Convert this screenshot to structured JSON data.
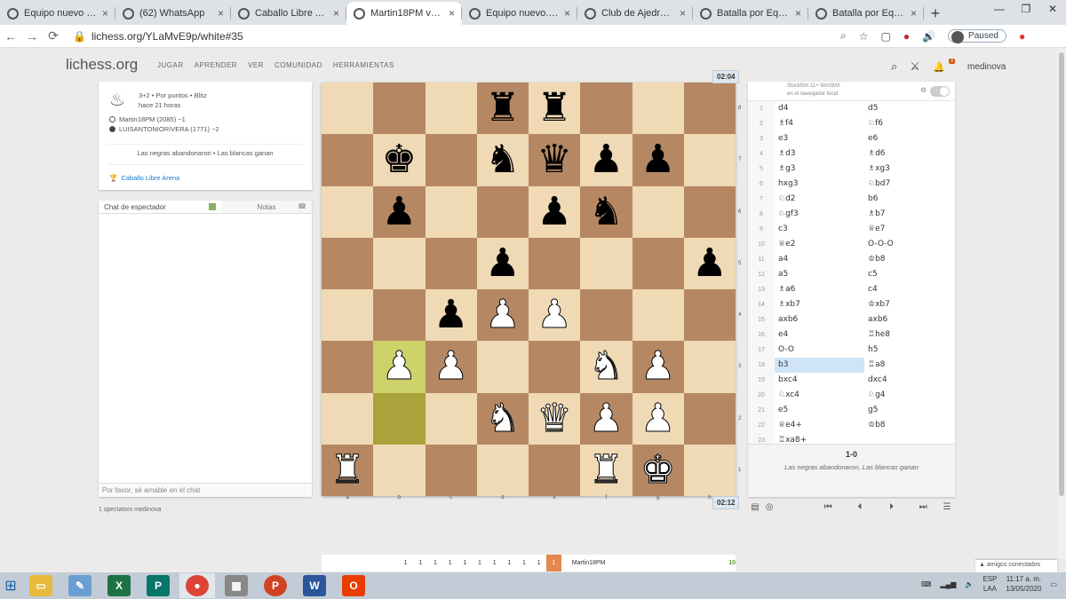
{
  "browser": {
    "tabs": [
      {
        "title": "Equipo nuevo • lich",
        "active": false
      },
      {
        "title": "(62) WhatsApp",
        "active": false
      },
      {
        "title": "Caballo Libre Arena",
        "active": false
      },
      {
        "title": "Martin18PM vs LU",
        "active": true
      },
      {
        "title": "Equipo nuevo. • lic",
        "active": false
      },
      {
        "title": "Club de Ajedrez Ca",
        "active": false
      },
      {
        "title": "Batalla por Equipo",
        "active": false
      },
      {
        "title": "Batalla por Equipos",
        "active": false
      }
    ],
    "url": "lichess.org/YLaMvE9p/white#35",
    "paused_label": "Paused"
  },
  "site": {
    "logo": "lichess.org",
    "menu": [
      "JUGAR",
      "APRENDER",
      "VER",
      "COMUNIDAD",
      "HERRAMIENTAS"
    ],
    "notif_count": "3",
    "username": "medinova"
  },
  "game_info": {
    "type": "3+2 • Por puntos • Blitz",
    "ago": "hace 21 horas",
    "white": "Martin18PM (2085) −1",
    "black": "LUISANTONIORIVERA (1771) −2",
    "result_text": "Las negras abandonaron • Las blancas ganan",
    "tournament": "Caballo Libre Arena"
  },
  "chat": {
    "tab_chat": "Chat de espectador",
    "tab_notes": "Notas",
    "placeholder": "Por favor, sé amable en el chat"
  },
  "spectators": "1 spectators medinova",
  "clocks": {
    "top": "02:04",
    "bottom": "02:12"
  },
  "board": {
    "rows": [
      [
        "",
        "",
        "",
        "r",
        "r",
        "",
        "",
        ""
      ],
      [
        "",
        "k",
        "",
        "n",
        "q",
        "p",
        "p",
        ""
      ],
      [
        "",
        "p",
        "",
        "",
        "p",
        "n",
        "",
        ""
      ],
      [
        "",
        "",
        "",
        "p",
        "",
        "",
        "",
        "p"
      ],
      [
        "",
        "",
        "p",
        "P",
        "P",
        "",
        "",
        ""
      ],
      [
        "",
        "P",
        "P",
        "",
        "",
        "N",
        "P",
        ""
      ],
      [
        "",
        "",
        "",
        "N",
        "Q",
        "P",
        "P",
        ""
      ],
      [
        "R",
        "",
        "",
        "",
        "",
        "R",
        "K",
        ""
      ]
    ],
    "highlight": [
      "b3",
      "b2"
    ],
    "ranks": [
      "8",
      "7",
      "6",
      "5",
      "4",
      "3",
      "2",
      "1"
    ],
    "files": [
      "a",
      "b",
      "c",
      "d",
      "e",
      "f",
      "g",
      "h"
    ]
  },
  "engine": {
    "name": "Stockfish 11+ WASMX",
    "sub": "en el navegador local"
  },
  "moves": [
    [
      "1",
      "d4",
      "d5"
    ],
    [
      "2",
      "♗f4",
      "♘f6"
    ],
    [
      "3",
      "e3",
      "e6"
    ],
    [
      "4",
      "♗d3",
      "♗d6"
    ],
    [
      "5",
      "♗g3",
      "♗xg3"
    ],
    [
      "6",
      "hxg3",
      "♘bd7"
    ],
    [
      "7",
      "♘d2",
      "b6"
    ],
    [
      "8",
      "♘gf3",
      "♗b7"
    ],
    [
      "9",
      "c3",
      "♕e7"
    ],
    [
      "10",
      "♕e2",
      "O-O-O"
    ],
    [
      "11",
      "a4",
      "♔b8"
    ],
    [
      "12",
      "a5",
      "c5"
    ],
    [
      "13",
      "♗a6",
      "c4"
    ],
    [
      "14",
      "♗xb7",
      "♔xb7"
    ],
    [
      "15",
      "axb6",
      "axb6"
    ],
    [
      "16",
      "e4",
      "♖he8"
    ],
    [
      "17",
      "O-O",
      "h5"
    ],
    [
      "18",
      "b3",
      "♖a8"
    ],
    [
      "19",
      "bxc4",
      "dxc4"
    ],
    [
      "20",
      "♘xc4",
      "♘g4"
    ],
    [
      "21",
      "e5",
      "g5"
    ],
    [
      "22",
      "♕e4+",
      "♔b8"
    ],
    [
      "23",
      "♖xa8+",
      ""
    ]
  ],
  "active_move": "18-w",
  "result": {
    "score": "1-0",
    "text": "Las negras abandonaron, Las blancas ganan"
  },
  "bottom_bar": {
    "numbers": [
      "1",
      "1",
      "1",
      "1",
      "1",
      "1",
      "1",
      "1",
      "1",
      "1"
    ],
    "current": "1",
    "player": "Martin18PM",
    "score": "10"
  },
  "friends": "▲ amigos conectados",
  "taskbar": {
    "lang": "ESP",
    "lang2": "LAA",
    "time": "11:17 a. m.",
    "date": "13/05/2020"
  }
}
